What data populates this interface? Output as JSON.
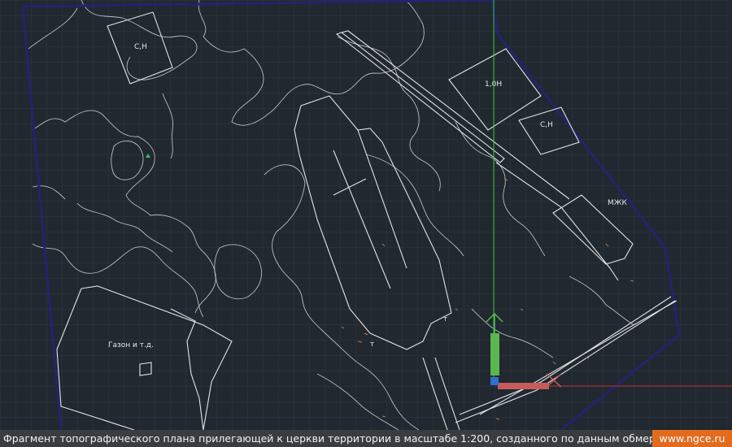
{
  "drawing": {
    "labels": {
      "building_tl": "С,Н",
      "building_right_top": "1,0Н",
      "building_right_small": "С,Н",
      "building_right_mid": "МЖК",
      "area_label": "Газон и т.д.",
      "tower_mark": "т"
    }
  },
  "footer": {
    "caption": "Фрагмент топографического плана прилегающей к церкви территории в масштабе 1:200, созданного по данным обмеров",
    "site": "www.ngce.ru"
  },
  "colors": {
    "background": "#212830",
    "grid": "#2d3744",
    "boundary": "#23236e",
    "linework": "#e4e4e4",
    "contours": "#b9bdc2",
    "ucs_y_axis": "#5bb74f",
    "ucs_x_axis": "#c65b5b",
    "crosshair_v": "#32c832",
    "crosshair_h": "#c83232",
    "caption_bg": "#3a3d40",
    "site_bg": "#e26b1e"
  }
}
